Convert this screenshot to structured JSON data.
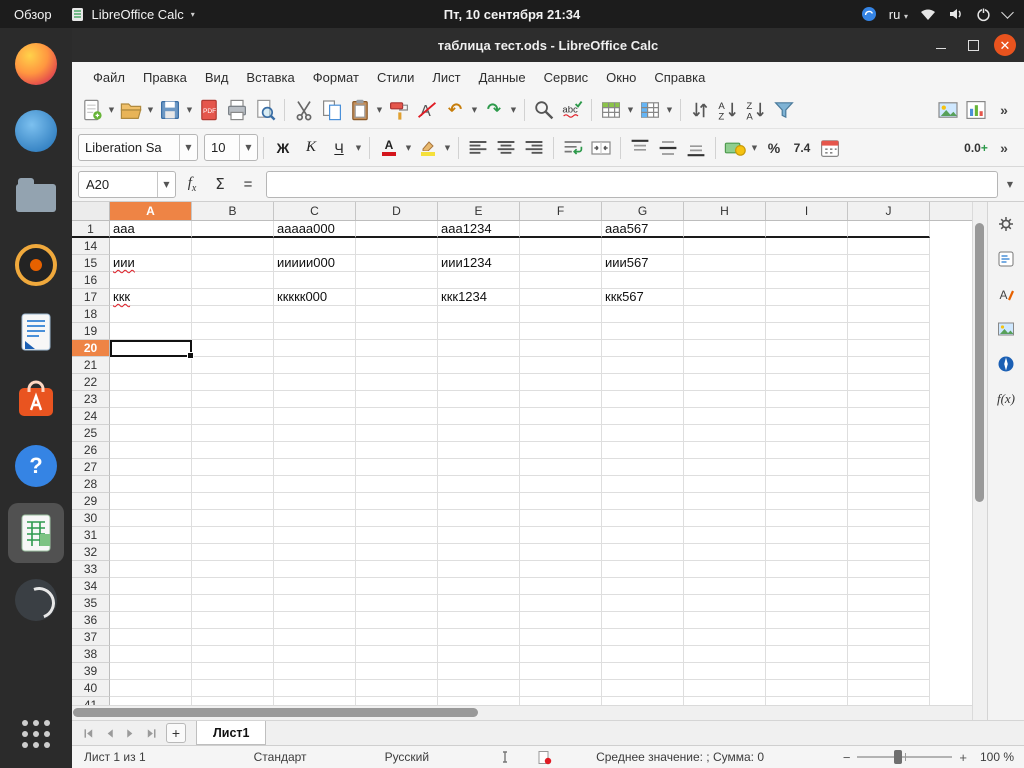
{
  "colors": {
    "accent": "#e95420",
    "selection_header": "#ee8445",
    "spellcheck_red": "#e01b24",
    "titlebar": "#2d2d2d"
  },
  "top_bar": {
    "activities": "Обзор",
    "app_menu": "LibreOffice Calc",
    "clock": "Пт, 10 сентября 21:34",
    "keyboard_layout": "ru",
    "right_icons": [
      "app-indicator-icon",
      "keyboard-layout",
      "network-icon",
      "volume-icon",
      "power-icon",
      "chevron-down-icon"
    ]
  },
  "window": {
    "title": "таблица тест.ods - LibreOffice Calc"
  },
  "menubar": {
    "items": [
      "Файл",
      "Правка",
      "Вид",
      "Вставка",
      "Формат",
      "Стили",
      "Лист",
      "Данные",
      "Сервис",
      "Окно",
      "Справка"
    ]
  },
  "toolbar_standard": {
    "icons": [
      "new-document",
      "open",
      "save",
      "export-pdf",
      "print",
      "print-preview",
      "cut",
      "copy",
      "paste",
      "clone-formatting",
      "clear-formatting",
      "undo",
      "redo",
      "find-and-replace",
      "spelling",
      "insert-row",
      "insert-column",
      "sort",
      "sort-ascending",
      "sort-descending",
      "autofilter",
      "insert-image",
      "insert-chart",
      "overflow"
    ],
    "undo_glyph": "↶",
    "redo_glyph": "↷",
    "overflow": "»"
  },
  "toolbar_formatting": {
    "font_name": "Liberation Sa",
    "font_size": "10",
    "bold": "Ж",
    "italic": "К",
    "underline": "Ч",
    "font_color_letter": "A",
    "spelling_sample": "abc",
    "percent": "%",
    "standard_number": "7.4",
    "add_decimal": "0.0",
    "overflow": "»"
  },
  "formula_bar": {
    "cell_reference": "A20",
    "fx_f": "f",
    "fx_x": "x",
    "sum": "Σ",
    "equals": "=",
    "formula_value": ""
  },
  "grid": {
    "columns": [
      "A",
      "B",
      "C",
      "D",
      "E",
      "F",
      "G",
      "H",
      "I",
      "J"
    ],
    "rows": [
      "1",
      "14",
      "15",
      "16",
      "17",
      "18",
      "19",
      "20",
      "21",
      "22",
      "23",
      "24",
      "25",
      "26",
      "27",
      "28",
      "29",
      "30",
      "31",
      "32",
      "33",
      "34",
      "35",
      "36",
      "37",
      "38",
      "39",
      "40",
      "41"
    ],
    "selected_column": "A",
    "selected_row": "20",
    "selected_cell": "A20",
    "hidden_break_after_row": "1",
    "cells": [
      {
        "row": "1",
        "col": "A",
        "text": "ааа",
        "spell_error": false
      },
      {
        "row": "1",
        "col": "C",
        "text": "ааааа000",
        "spell_error": false
      },
      {
        "row": "1",
        "col": "E",
        "text": "ааа1234",
        "spell_error": false
      },
      {
        "row": "1",
        "col": "G",
        "text": "ааа567",
        "spell_error": false
      },
      {
        "row": "15",
        "col": "A",
        "text": "иии",
        "spell_error": true
      },
      {
        "row": "15",
        "col": "C",
        "text": "иииии000",
        "spell_error": false
      },
      {
        "row": "15",
        "col": "E",
        "text": "иии1234",
        "spell_error": false
      },
      {
        "row": "15",
        "col": "G",
        "text": "иии567",
        "spell_error": false
      },
      {
        "row": "17",
        "col": "A",
        "text": "ккк",
        "spell_error": true
      },
      {
        "row": "17",
        "col": "C",
        "text": "ккккк000",
        "spell_error": false
      },
      {
        "row": "17",
        "col": "E",
        "text": "ккк1234",
        "spell_error": false
      },
      {
        "row": "17",
        "col": "G",
        "text": "ккк567",
        "spell_error": false
      }
    ]
  },
  "sheet_tabs": {
    "tabs": [
      "Лист1"
    ]
  },
  "status_bar": {
    "sheet_position": "Лист 1 из 1",
    "page_style": "Стандарт",
    "text_language": "Русский",
    "stats": "Среднее значение: ; Сумма: 0",
    "zoom_minus": "−",
    "zoom_plus": "+",
    "zoom_level": "100 %"
  },
  "dock": {
    "items": [
      "firefox",
      "thunderbird",
      "files",
      "rhythmbox",
      "libreoffice-writer",
      "ubuntu-software",
      "help",
      "libreoffice-calc",
      "spiral-app",
      "show-applications"
    ],
    "active": "libreoffice-calc"
  },
  "sidebar": {
    "icons": [
      "sidebar-settings",
      "properties",
      "styles",
      "gallery",
      "navigator",
      "functions"
    ],
    "functions_label": "f(x)"
  }
}
